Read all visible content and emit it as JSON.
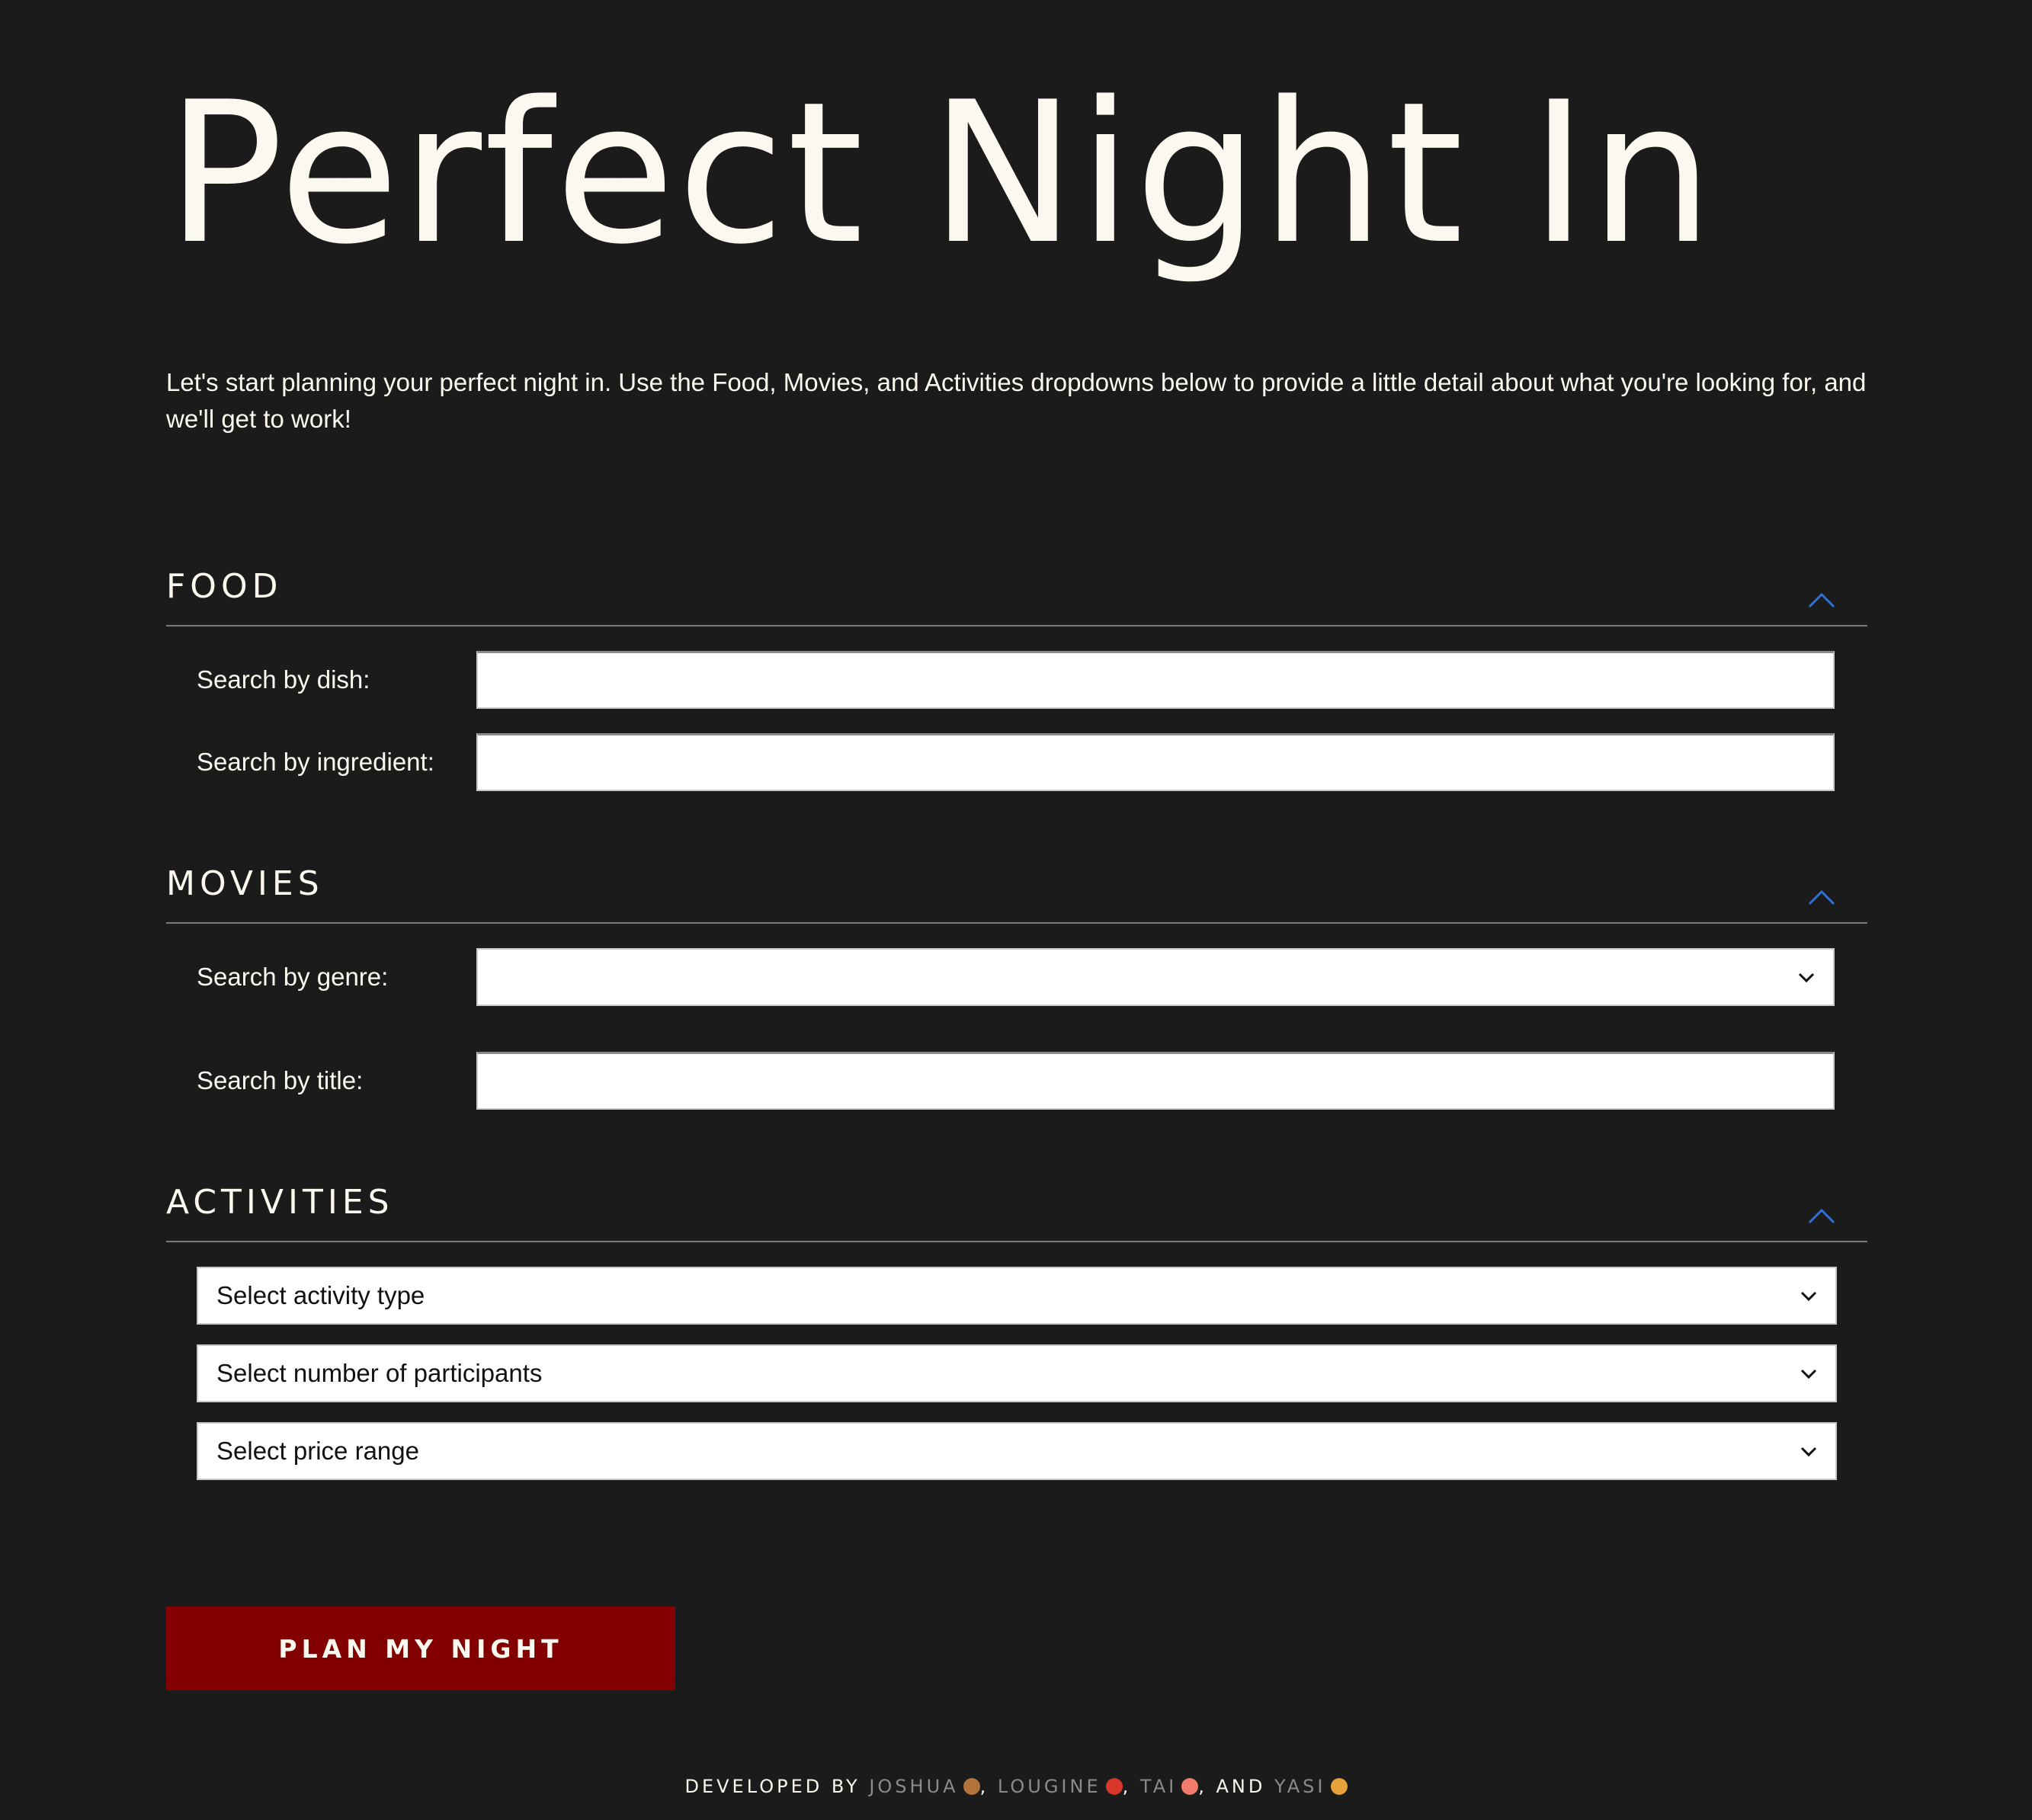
{
  "page": {
    "title": "Perfect Night In",
    "intro": "Let's start planning your perfect night in. Use the Food, Movies, and Activities dropdowns below to provide a little detail about what you're looking for, and we'll get to work!"
  },
  "colors": {
    "background": "#1b1b1b",
    "text": "#fbf8ef",
    "accent_chevron": "#2f6fd6",
    "button": "#820000",
    "footer_name": "#8b8b8b"
  },
  "food": {
    "title": "FOOD",
    "dish_label": "Search by dish:",
    "dish_value": "",
    "ingredient_label": "Search by ingredient:",
    "ingredient_value": ""
  },
  "movies": {
    "title": "MOVIES",
    "genre_label": "Search by genre:",
    "genre_selected": "",
    "title_label": "Search by title:",
    "title_value": ""
  },
  "activities": {
    "title": "ACTIVITIES",
    "type_selected": "Select activity type",
    "participants_selected": "Select number of participants",
    "price_selected": "Select price range"
  },
  "icons": {
    "section_toggle": "chevron-up-icon",
    "select_arrow": "chevron-down-icon"
  },
  "button": {
    "label": "PLAN MY NIGHT"
  },
  "footer": {
    "prefix": "DEVELOPED BY",
    "developers": [
      {
        "name": "JOSHUA",
        "emoji": "donut-emoji"
      },
      {
        "name": "LOUGINE",
        "emoji": "lobster-emoji"
      },
      {
        "name": "TAI",
        "emoji": "sushi-emoji"
      },
      {
        "name": "YASI",
        "emoji": "pizza-emoji"
      }
    ],
    "sep1": ",",
    "sep2": ",",
    "sep3": ",",
    "and": "AND"
  }
}
